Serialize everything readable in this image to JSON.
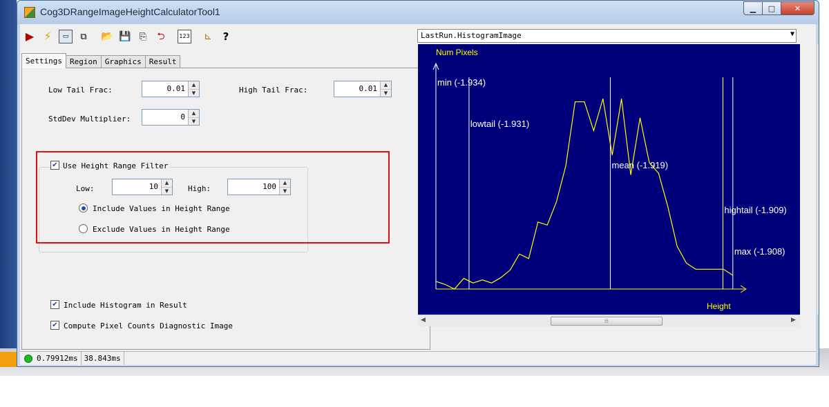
{
  "window": {
    "title": "Cog3DRangeImageHeightCalculatorTool1"
  },
  "tabs": [
    "Settings",
    "Region",
    "Graphics",
    "Result"
  ],
  "settings": {
    "low_tail_label": "Low Tail Frac:",
    "low_tail_value": "0.01",
    "high_tail_label": "High Tail Frac:",
    "high_tail_value": "0.01",
    "stddev_label": "StdDev Multiplier:",
    "stddev_value": "0",
    "height_filter": {
      "label": "Use Height Range Filter",
      "checked": true,
      "low_label": "Low:",
      "low_value": "10",
      "high_label": "High:",
      "high_value": "100",
      "include_label": "Include Values in Height Range",
      "exclude_label": "Exclude Values in Height Range",
      "selected": "include"
    },
    "include_histogram_label": "Include Histogram in Result",
    "compute_pixel_counts_label": "Compute Pixel Counts Diagnostic Image"
  },
  "status": {
    "time1": "0.79912ms",
    "time2": "38.843ms"
  },
  "image_select": {
    "value": "LastRun.HistogramImage"
  },
  "chart_data": {
    "type": "line",
    "ylabel": "Num Pixels",
    "xlabel": "Height",
    "colors": {
      "background": "#00007a",
      "curve": "#ffff00",
      "markers": "#ffffff"
    },
    "values": [
      10,
      6,
      0,
      14,
      8,
      12,
      8,
      15,
      25,
      46,
      40,
      88,
      84,
      115,
      162,
      246,
      246,
      208,
      250,
      176,
      250,
      150,
      225,
      166,
      152,
      108,
      56,
      34,
      26,
      26,
      26,
      26,
      18
    ],
    "markers": [
      {
        "label": "min (-1.934)",
        "x": 0.0
      },
      {
        "label": "lowtail (-1.931)",
        "x": 1.5
      },
      {
        "label": "mean (-1.919)",
        "x": 7.9
      },
      {
        "label": "hightail (-1.909)",
        "x": 13.0
      },
      {
        "label": "max (-1.908)",
        "x": 13.45
      }
    ],
    "x_range": [
      0,
      13.8
    ],
    "y_range": [
      0,
      290
    ]
  }
}
